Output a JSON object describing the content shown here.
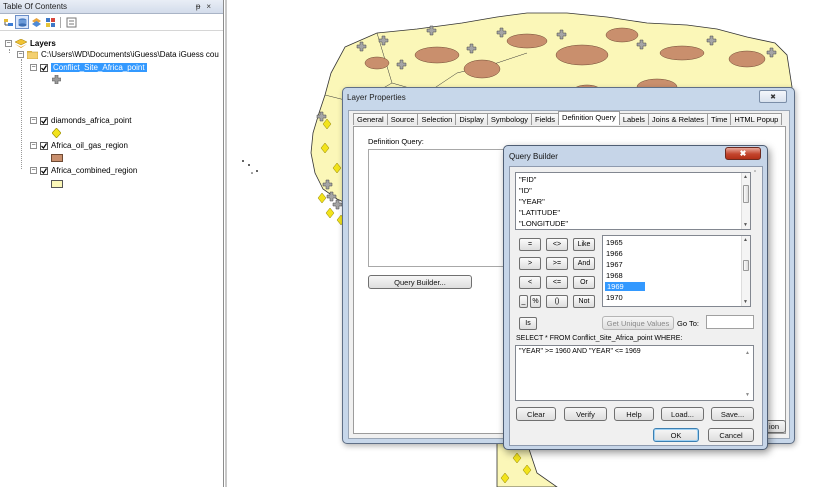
{
  "toc": {
    "title": "Table Of Contents",
    "pin": "p",
    "close": "×",
    "layers_label": "Layers",
    "path_label": "C:\\Users\\WD\\Documents\\iGuess\\Data iGuess cou",
    "layers": [
      {
        "name": "Conflict_Site_Africa_point",
        "symbol": "plus"
      },
      {
        "name": "diamonds_africa_point",
        "symbol": "diamond"
      },
      {
        "name": "Africa_oil_gas_region",
        "symbol": "rect-brown"
      },
      {
        "name": "Africa_combined_region",
        "symbol": "rect-yellow"
      }
    ]
  },
  "colors": {
    "land": "#fbf7b8",
    "oil": "#c98f6d",
    "point": "#8c8c8c",
    "diamond": "#f2e31c",
    "selection": "#3399ff"
  },
  "layer_properties": {
    "title": "Layer Properties",
    "close_glyph": "✖",
    "tabs": [
      "General",
      "Source",
      "Selection",
      "Display",
      "Symbology",
      "Fields",
      "Definition Query",
      "Labels",
      "Joins & Relates",
      "Time",
      "HTML Popup"
    ],
    "active_tab": "Definition Query",
    "definition_query_label": "Definition Query:",
    "query_builder_button": "Query Builder...",
    "apply_button": "ion"
  },
  "query_builder": {
    "title": "Query Builder",
    "close_glyph": "✖",
    "fields": [
      "\"FID\"",
      "\"ID\"",
      "\"YEAR\"",
      "\"LATITUDE\"",
      "\"LONGITUDE\""
    ],
    "selected_field": "\"YEAR\"",
    "operators": [
      "=",
      "<>",
      "Like",
      ">",
      ">=",
      "And",
      "<",
      "<=",
      "Or",
      "_",
      "%",
      "()",
      "Not",
      "Is"
    ],
    "values": [
      "1965",
      "1966",
      "1967",
      "1968",
      "1969",
      "1970"
    ],
    "selected_value": "1969",
    "unique_values_button": "Get Unique Values",
    "goto_label": "Go To:",
    "select_label": "SELECT * FROM Conflict_Site_Africa_point WHERE:",
    "expression": "\"YEAR\" >= 1960 AND \"YEAR\" <= 1969",
    "buttons": {
      "clear": "Clear",
      "verify": "Verify",
      "help": "Help",
      "load": "Load...",
      "save": "Save...",
      "ok": "OK",
      "cancel": "Cancel"
    }
  }
}
